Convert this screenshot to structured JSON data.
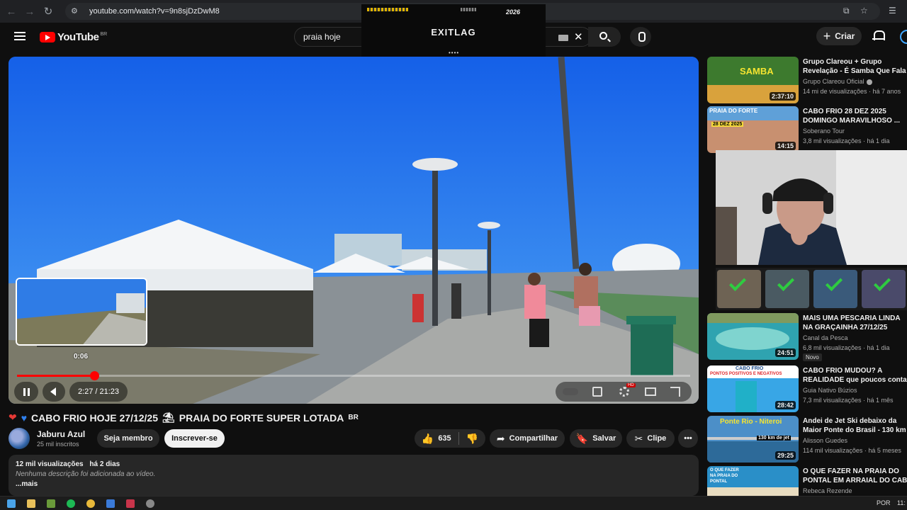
{
  "browser": {
    "url": "youtube.com/watch?v=9n8sjDzDwM8"
  },
  "masthead": {
    "logo_text": "YouTube",
    "logo_country": "BR",
    "search_query": "praia hoje",
    "create_label": "Criar"
  },
  "overlay_ad": {
    "brand": "EXITLAG",
    "tag": "2026",
    "dots": "••••"
  },
  "player": {
    "hover_time": "0:06",
    "time_display": "2:27 / 21:23",
    "progress_fraction": 0.115
  },
  "video": {
    "title": "CABO FRIO HOJE 27/12/25",
    "title_part2": "PRAIA DO FORTE SUPER LOTADA",
    "title_tag": "BR",
    "channel_name": "Jaburu Azul",
    "subscribers": "25 mil inscritos",
    "member_label": "Seja membro",
    "subscribe_label": "Inscrever-se",
    "likes": "635",
    "share_label": "Compartilhar",
    "save_label": "Salvar",
    "clip_label": "Clipe",
    "views": "12 mil visualizações",
    "age": "há 2 dias",
    "description": "Nenhuma descrição foi adicionada ao vídeo.",
    "more_label": "...mais"
  },
  "recommendations": [
    {
      "title1": "Grupo Clareou + Grupo",
      "title2": "Revelação - É Samba Que Fala",
      "channel": "Grupo Clareou Oficial",
      "meta": "14 mi de visualizações · há 7 anos",
      "duration": "2:37:10",
      "verified": true
    },
    {
      "title1": "CABO FRIO 28 DEZ 2025",
      "title2": "DOMINGO MARAVILHOSO ...",
      "channel": "Soberano Tour",
      "meta": "3,8 mil visualizações · há 1 dia",
      "duration": "14:15",
      "thumb_text": "PRAIA DO FORTE",
      "thumb_date": "28 DEZ 2025"
    },
    {
      "title1": "MAIS UMA PESCARIA LINDA",
      "title2": "NA GRAÇAINHA 27/12/25",
      "channel": "Canal da Pesca",
      "meta": "6,8 mil visualizações · há 1 dia",
      "duration": "24:51",
      "badge": "Novo"
    },
    {
      "title1": "CABO FRIO MUDOU? A",
      "title2": "REALIDADE que poucos contam",
      "channel": "Guia Nativo Búzios",
      "meta": "7,3 mil visualizações · há 1 mês",
      "duration": "28:42",
      "thumb_text": "CABO FRIO",
      "thumb_sub": "PONTOS POSITIVOS E NEGATIVOS"
    },
    {
      "title1": "Andei de Jet Ski debaixo da",
      "title2": "Maior Ponte do Brasil - 130 km",
      "channel": "Alisson Guedes",
      "meta": "114 mil visualizações · há 5 meses",
      "duration": "29:25",
      "thumb_text": "Ponte Rio - Niteroi",
      "thumb_sub": "130 km de jet"
    },
    {
      "title1": "O QUE FAZER NA PRAIA DO",
      "title2": "PONTAL EM ARRAIAL DO CABO",
      "channel": "Rebeca Rezende",
      "thumb_text": "O QUE FAZER NA PRAIA DO PONTAL"
    }
  ],
  "taskbar": {
    "lang": "POR",
    "clock": "11:"
  },
  "colors": {
    "accent_red": "#ff0000",
    "bg": "#0f0f0f",
    "pill_bg": "#272727"
  }
}
